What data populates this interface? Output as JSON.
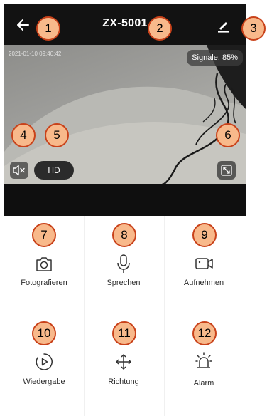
{
  "header": {
    "title": "ZX-5001",
    "back_icon": "back-arrow-icon",
    "edit_icon": "pencil-icon"
  },
  "video": {
    "timestamp": "2021-01-10 09:40:42",
    "signal_label": "Signale: 85%",
    "quality_label": "HD",
    "mute_icon": "speaker-mute-icon",
    "fullscreen_icon": "fullscreen-icon"
  },
  "actions": [
    {
      "label": "Fotografieren",
      "icon": "camera-icon"
    },
    {
      "label": "Sprechen",
      "icon": "microphone-icon"
    },
    {
      "label": "Aufnehmen",
      "icon": "video-record-icon"
    },
    {
      "label": "Wiedergabe",
      "icon": "playback-icon"
    },
    {
      "label": "Richtung",
      "icon": "direction-arrows-icon"
    },
    {
      "label": "Alarm",
      "icon": "alarm-light-icon"
    }
  ],
  "callouts": [
    "1",
    "2",
    "3",
    "4",
    "5",
    "6",
    "7",
    "8",
    "9",
    "10",
    "11",
    "12"
  ],
  "colors": {
    "topbar": "#121212",
    "callout_fill": "#f8b98b",
    "callout_border": "#c9421a"
  }
}
